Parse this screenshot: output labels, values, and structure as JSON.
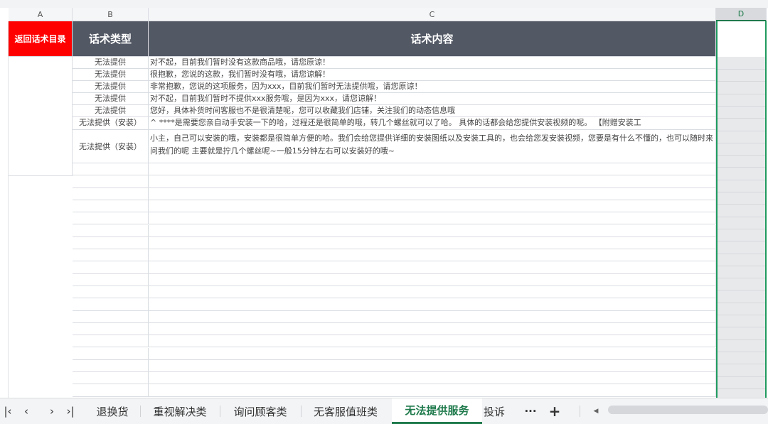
{
  "columns": [
    "A",
    "B",
    "C",
    "D"
  ],
  "header": {
    "back_link": "返回话术目录",
    "type_header": "话术类型",
    "content_header": "话术内容"
  },
  "rows": [
    {
      "type": "无法提供",
      "content": "对不起，目前我们暂时没有这款商品哦，请您原谅！"
    },
    {
      "type": "无法提供",
      "content": "很抱歉，您说的这款，我们暂时没有哦，请您谅解！"
    },
    {
      "type": "无法提供",
      "content": "非常抱歉，您说的这项服务，因为xxx，目前我们暂时无法提供哦，请您原谅！"
    },
    {
      "type": "无法提供",
      "content": "对不起，目前我们暂时不提供xxx服务哦，是因为xxx，请您谅解！"
    },
    {
      "type": "无法提供",
      "content": "您好，具体补货时间客服也不是很清楚呢，您可以收藏我们店铺，关注我们的动态信息哦"
    },
    {
      "type": "无法提供（安装）",
      "content": "^ ****是需要您亲自动手安装一下的哈，过程还是很简单的哦，转几个螺丝就可以了哈。 具体的话都会给您提供安装视频的呢。 【附赠安装工"
    },
    {
      "type": "无法提供（安装）",
      "content": "小主，自己可以安装的哦，安装都是很简单方便的哈。我们会给您提供详细的安装图纸以及安装工具的，也会给您发安装视频，您要是有什么不懂的，也可以随时来问我们的呢 主要就是拧几个螺丝呢~一般15分钟左右可以安装好的哦~"
    }
  ],
  "tabs": {
    "nav_first": "|‹",
    "nav_prev": "‹",
    "nav_next": "›",
    "nav_last": "›|",
    "items": [
      "退换货",
      "重视解决类",
      "询问顾客类",
      "无客服值班类",
      "无法提供服务",
      "投诉"
    ],
    "active": "无法提供服务",
    "more": "···",
    "add": "+"
  },
  "colors": {
    "back_bg": "#ff0000",
    "header_bg": "#525864",
    "active_tab": "#1f7a4c"
  }
}
